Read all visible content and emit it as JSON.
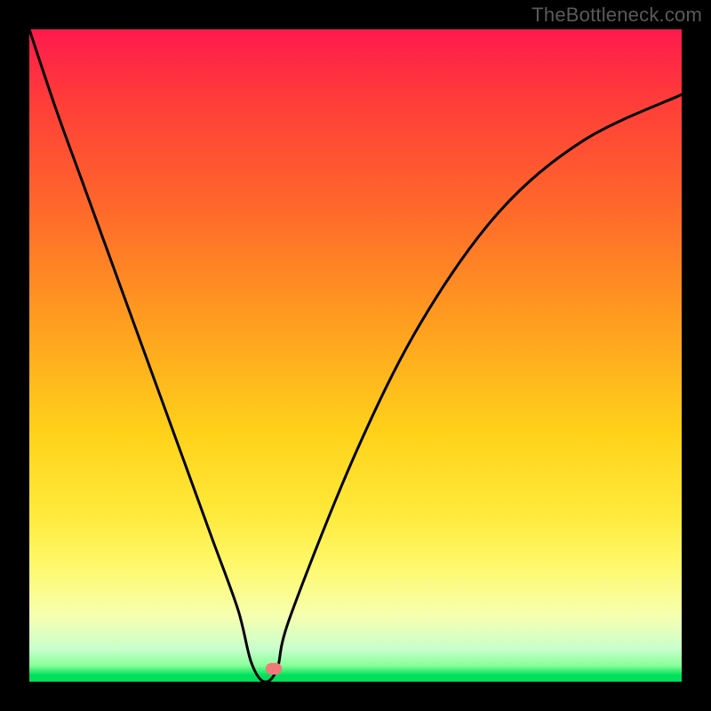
{
  "watermark": "TheBottleneck.com",
  "colors": {
    "frame": "#000000",
    "curve": "#000000",
    "marker": "#f07a7a"
  },
  "chart_data": {
    "type": "line",
    "title": "",
    "xlabel": "",
    "ylabel": "",
    "xlim": [
      0,
      100
    ],
    "ylim": [
      0,
      100
    ],
    "grid": false,
    "legend": false,
    "background": "vertical-gradient",
    "gradient_stops": [
      {
        "pos": 0,
        "color": "#ff1a4d"
      },
      {
        "pos": 28,
        "color": "#ff6a2a"
      },
      {
        "pos": 62,
        "color": "#ffd21a"
      },
      {
        "pos": 82,
        "color": "#fff86a"
      },
      {
        "pos": 95,
        "color": "#c8ffcc"
      },
      {
        "pos": 100,
        "color": "#00e05a"
      }
    ],
    "series": [
      {
        "name": "bottleneck-curve",
        "x_pct": [
          0,
          4,
          8,
          12,
          16,
          20,
          24,
          28,
          32,
          34,
          36,
          38,
          40,
          50,
          60,
          72,
          85,
          100
        ],
        "y_pct": [
          100,
          88,
          77,
          66,
          55,
          44,
          33,
          22,
          11,
          3,
          0,
          2,
          10,
          35,
          55,
          72,
          83,
          90
        ]
      }
    ],
    "series_note": "y_pct is percent of full height from bottom. Curve plunges from top-left to a sharp minimum near x≈36%, then rises with decreasing slope toward the upper right.",
    "marker": {
      "x_pct": 37.5,
      "y_pct": 2
    }
  }
}
